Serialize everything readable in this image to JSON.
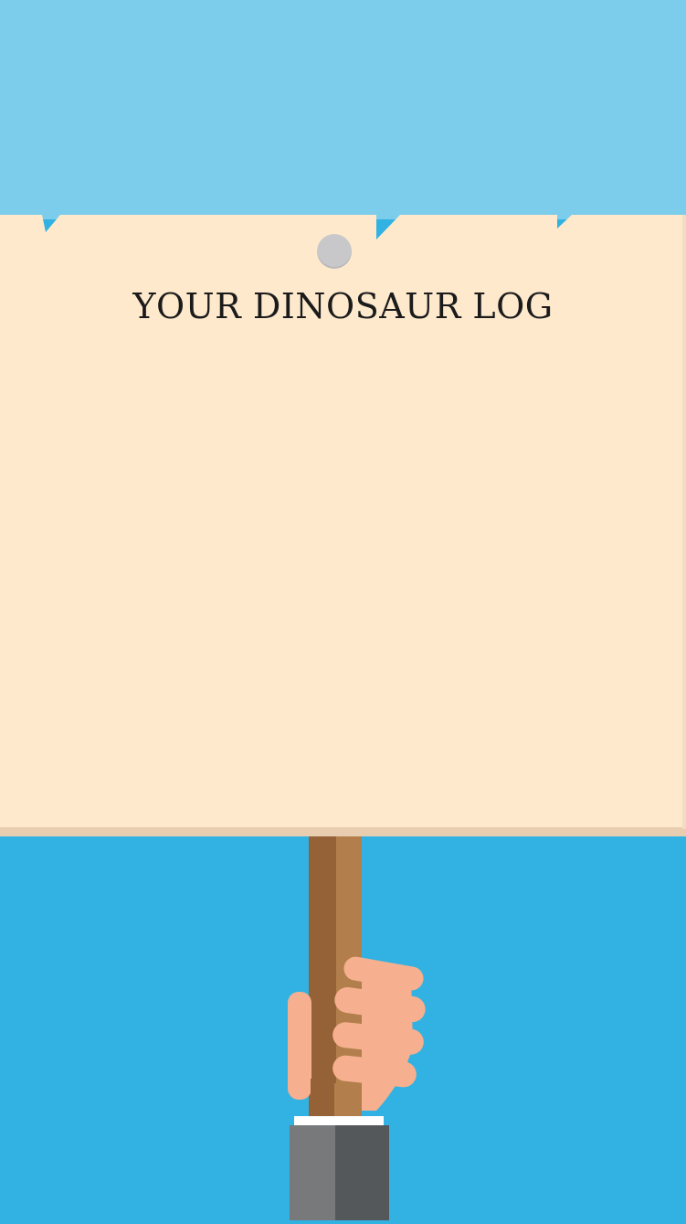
{
  "sign": {
    "title": "YOUR DINOSAUR LOG"
  },
  "colors": {
    "sky_top": "#7ccdeb",
    "sky_bottom": "#31b2e2",
    "sign_paper": "#fee9cd",
    "sign_edge": "#e9cdb0",
    "pin": "#c8c8ca",
    "pole_dark": "#956136",
    "pole_light": "#b27f4c",
    "skin": "#f6b08f",
    "cuff": "#ffffff",
    "sleeve_light": "#78797b",
    "sleeve_dark": "#55585a"
  },
  "icons": {
    "pin": "pushpin-icon",
    "hand": "hand-holding-sign-icon"
  }
}
